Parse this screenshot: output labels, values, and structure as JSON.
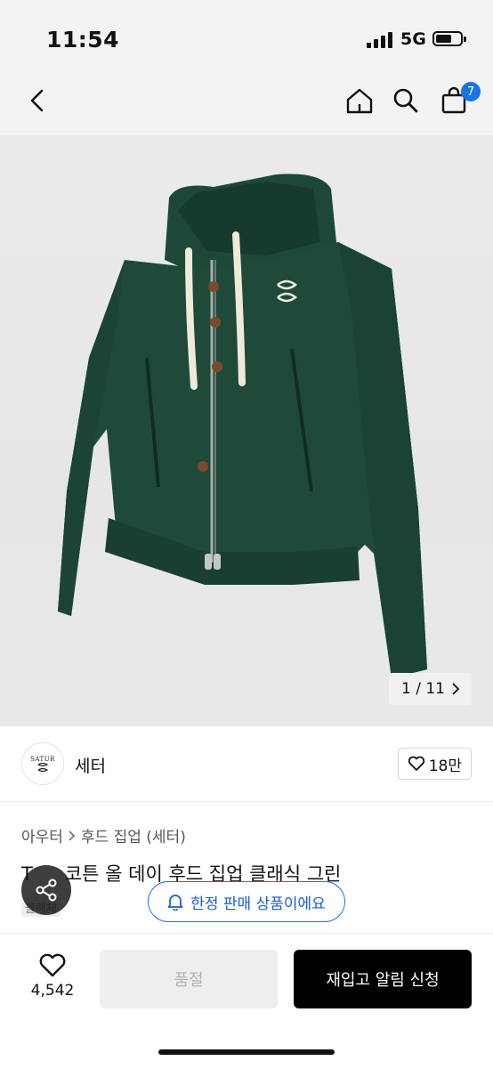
{
  "status_bar": {
    "time": "11:54",
    "network": "5G"
  },
  "nav": {
    "cart_count": "7",
    "icons": [
      "back-icon",
      "home-icon",
      "search-icon",
      "cart-icon"
    ]
  },
  "gallery": {
    "counter": "1 / 11",
    "image": "green zip-up hoodie with white drawstrings",
    "colors": {
      "hoodie": "#1f4a3a"
    }
  },
  "brand": {
    "logo_text": "SATUR",
    "name": "세터",
    "likes": "18만"
  },
  "product": {
    "breadcrumb": [
      "아우터",
      "후드 집업 (세터)"
    ],
    "title": "코튼 올 데이 후드 집업 클래식 그린",
    "title_prefix": "T",
    "tag": "블랙체"
  },
  "limited_badge": "한정 판매 상품이에요",
  "bottom_bar": {
    "wish_count": "4,542",
    "soldout_label": "품절",
    "restock_label": "재입고 알림 신청"
  },
  "colors": {
    "accent": "#2a6ee8",
    "primary_button": "#000000",
    "disabled_button": "#eeeeee"
  }
}
